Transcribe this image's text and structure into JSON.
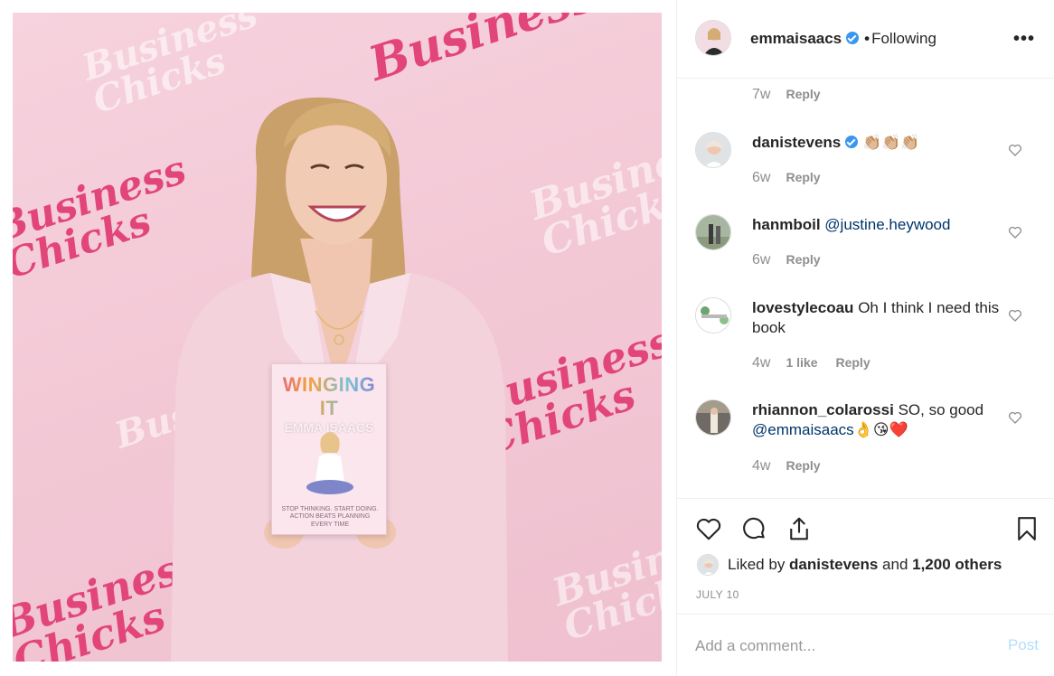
{
  "post": {
    "author": "emmaisaacs",
    "separator": "•",
    "follow_status": "Following",
    "more_icon": "ellipsis-icon"
  },
  "photo": {
    "watermark": "Business Chicks",
    "watermark_line1": "Business",
    "watermark_line2": "Chicks",
    "watermark_color": "#e2457a",
    "background_color": "#f3c9d6",
    "book_title": "WINGING IT",
    "book_author": "EMMA ISAACS",
    "book_tagline": "STOP THINKING. START DOING. ACTION BEATS PLANNING EVERY TIME"
  },
  "comments": [
    {
      "user": "",
      "text": "",
      "age": "7w",
      "likes": "",
      "reply": "Reply"
    },
    {
      "user": "danistevens",
      "verified": true,
      "text": "👏🏼👏🏼👏🏼",
      "age": "6w",
      "likes": "",
      "reply": "Reply"
    },
    {
      "user": "hanmboil",
      "mention": "@justine.heywood",
      "text": "",
      "age": "6w",
      "likes": "",
      "reply": "Reply"
    },
    {
      "user": "lovestylecoau",
      "text": "Oh I think I need this book",
      "age": "4w",
      "likes": "1 like",
      "reply": "Reply"
    },
    {
      "user": "rhiannon_colarossi",
      "text": "SO, so good",
      "mention": "@emmaisaacs",
      "emoji": "👌😘❤️",
      "age": "4w",
      "likes": "",
      "reply": "Reply"
    }
  ],
  "actions": {
    "like_icon": "heart-icon",
    "comment_icon": "comment-icon",
    "share_icon": "share-icon",
    "save_icon": "bookmark-icon"
  },
  "likes": {
    "prefix": "Liked by ",
    "user": "danistevens",
    "middle": " and ",
    "others": "1,200 others"
  },
  "date": "JULY 10",
  "add_comment": {
    "placeholder": "Add a comment...",
    "post_label": "Post"
  },
  "colors": {
    "link": "#003569",
    "verified": "#3897f0",
    "muted": "#8e8e8e",
    "post_disabled": "#b2dffc"
  }
}
